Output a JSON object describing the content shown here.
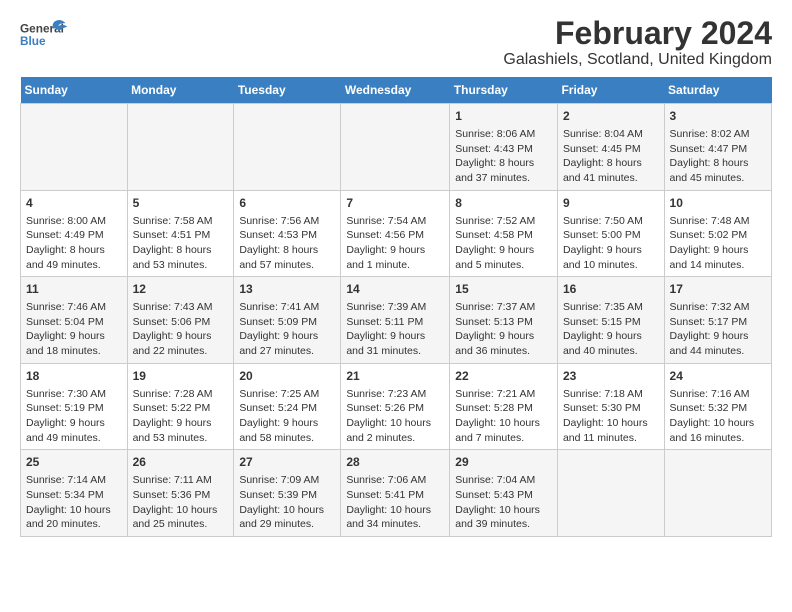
{
  "header": {
    "logo_general": "General",
    "logo_blue": "Blue",
    "title": "February 2024",
    "subtitle": "Galashiels, Scotland, United Kingdom"
  },
  "days_of_week": [
    "Sunday",
    "Monday",
    "Tuesday",
    "Wednesday",
    "Thursday",
    "Friday",
    "Saturday"
  ],
  "weeks": [
    [
      {
        "day": "",
        "info": ""
      },
      {
        "day": "",
        "info": ""
      },
      {
        "day": "",
        "info": ""
      },
      {
        "day": "",
        "info": ""
      },
      {
        "day": "1",
        "info": "Sunrise: 8:06 AM\nSunset: 4:43 PM\nDaylight: 8 hours\nand 37 minutes."
      },
      {
        "day": "2",
        "info": "Sunrise: 8:04 AM\nSunset: 4:45 PM\nDaylight: 8 hours\nand 41 minutes."
      },
      {
        "day": "3",
        "info": "Sunrise: 8:02 AM\nSunset: 4:47 PM\nDaylight: 8 hours\nand 45 minutes."
      }
    ],
    [
      {
        "day": "4",
        "info": "Sunrise: 8:00 AM\nSunset: 4:49 PM\nDaylight: 8 hours\nand 49 minutes."
      },
      {
        "day": "5",
        "info": "Sunrise: 7:58 AM\nSunset: 4:51 PM\nDaylight: 8 hours\nand 53 minutes."
      },
      {
        "day": "6",
        "info": "Sunrise: 7:56 AM\nSunset: 4:53 PM\nDaylight: 8 hours\nand 57 minutes."
      },
      {
        "day": "7",
        "info": "Sunrise: 7:54 AM\nSunset: 4:56 PM\nDaylight: 9 hours\nand 1 minute."
      },
      {
        "day": "8",
        "info": "Sunrise: 7:52 AM\nSunset: 4:58 PM\nDaylight: 9 hours\nand 5 minutes."
      },
      {
        "day": "9",
        "info": "Sunrise: 7:50 AM\nSunset: 5:00 PM\nDaylight: 9 hours\nand 10 minutes."
      },
      {
        "day": "10",
        "info": "Sunrise: 7:48 AM\nSunset: 5:02 PM\nDaylight: 9 hours\nand 14 minutes."
      }
    ],
    [
      {
        "day": "11",
        "info": "Sunrise: 7:46 AM\nSunset: 5:04 PM\nDaylight: 9 hours\nand 18 minutes."
      },
      {
        "day": "12",
        "info": "Sunrise: 7:43 AM\nSunset: 5:06 PM\nDaylight: 9 hours\nand 22 minutes."
      },
      {
        "day": "13",
        "info": "Sunrise: 7:41 AM\nSunset: 5:09 PM\nDaylight: 9 hours\nand 27 minutes."
      },
      {
        "day": "14",
        "info": "Sunrise: 7:39 AM\nSunset: 5:11 PM\nDaylight: 9 hours\nand 31 minutes."
      },
      {
        "day": "15",
        "info": "Sunrise: 7:37 AM\nSunset: 5:13 PM\nDaylight: 9 hours\nand 36 minutes."
      },
      {
        "day": "16",
        "info": "Sunrise: 7:35 AM\nSunset: 5:15 PM\nDaylight: 9 hours\nand 40 minutes."
      },
      {
        "day": "17",
        "info": "Sunrise: 7:32 AM\nSunset: 5:17 PM\nDaylight: 9 hours\nand 44 minutes."
      }
    ],
    [
      {
        "day": "18",
        "info": "Sunrise: 7:30 AM\nSunset: 5:19 PM\nDaylight: 9 hours\nand 49 minutes."
      },
      {
        "day": "19",
        "info": "Sunrise: 7:28 AM\nSunset: 5:22 PM\nDaylight: 9 hours\nand 53 minutes."
      },
      {
        "day": "20",
        "info": "Sunrise: 7:25 AM\nSunset: 5:24 PM\nDaylight: 9 hours\nand 58 minutes."
      },
      {
        "day": "21",
        "info": "Sunrise: 7:23 AM\nSunset: 5:26 PM\nDaylight: 10 hours\nand 2 minutes."
      },
      {
        "day": "22",
        "info": "Sunrise: 7:21 AM\nSunset: 5:28 PM\nDaylight: 10 hours\nand 7 minutes."
      },
      {
        "day": "23",
        "info": "Sunrise: 7:18 AM\nSunset: 5:30 PM\nDaylight: 10 hours\nand 11 minutes."
      },
      {
        "day": "24",
        "info": "Sunrise: 7:16 AM\nSunset: 5:32 PM\nDaylight: 10 hours\nand 16 minutes."
      }
    ],
    [
      {
        "day": "25",
        "info": "Sunrise: 7:14 AM\nSunset: 5:34 PM\nDaylight: 10 hours\nand 20 minutes."
      },
      {
        "day": "26",
        "info": "Sunrise: 7:11 AM\nSunset: 5:36 PM\nDaylight: 10 hours\nand 25 minutes."
      },
      {
        "day": "27",
        "info": "Sunrise: 7:09 AM\nSunset: 5:39 PM\nDaylight: 10 hours\nand 29 minutes."
      },
      {
        "day": "28",
        "info": "Sunrise: 7:06 AM\nSunset: 5:41 PM\nDaylight: 10 hours\nand 34 minutes."
      },
      {
        "day": "29",
        "info": "Sunrise: 7:04 AM\nSunset: 5:43 PM\nDaylight: 10 hours\nand 39 minutes."
      },
      {
        "day": "",
        "info": ""
      },
      {
        "day": "",
        "info": ""
      }
    ]
  ]
}
